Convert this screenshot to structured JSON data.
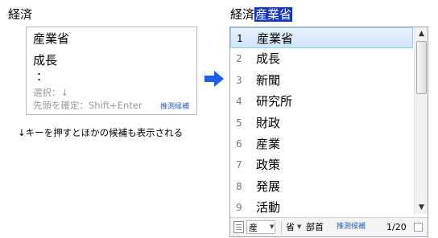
{
  "left": {
    "title": "経済",
    "candidates": [
      "産業省",
      "成長"
    ],
    "ellipsis": "：",
    "hint_select": "選択：↓",
    "hint_confirm": "先頭を確定：Shift+Enter",
    "prediction_tag": "推測候補"
  },
  "bottom_note": "↓キーを押すとほかの候補も表示される",
  "right": {
    "title_prefix": "経済",
    "title_highlight": "産業省",
    "candidates": [
      {
        "num": "1",
        "text": "産業省"
      },
      {
        "num": "2",
        "text": "成長"
      },
      {
        "num": "3",
        "text": "新聞"
      },
      {
        "num": "4",
        "text": "研究所"
      },
      {
        "num": "5",
        "text": "財政"
      },
      {
        "num": "6",
        "text": "産業"
      },
      {
        "num": "7",
        "text": "政策"
      },
      {
        "num": "8",
        "text": "発展"
      },
      {
        "num": "9",
        "text": "活動"
      }
    ],
    "selected_index": 0,
    "toolbar": {
      "dict_label": "産",
      "dict2_label": "省",
      "bushu_label": "部首",
      "prediction_tag": "推測候補",
      "page_indicator": "1/20"
    }
  },
  "colors": {
    "highlight": "#1433c8",
    "arrow": "#1a5ff0",
    "selection": "#cfe6fb",
    "hint_text": "#9a9a9a",
    "tag_text": "#2a5fb0"
  },
  "icons": {
    "arrow": "right-arrow-icon",
    "scroll_up": "triangle-up-icon",
    "scroll_down": "triangle-down-icon",
    "document": "document-icon",
    "resize": "resize-grip-icon"
  }
}
